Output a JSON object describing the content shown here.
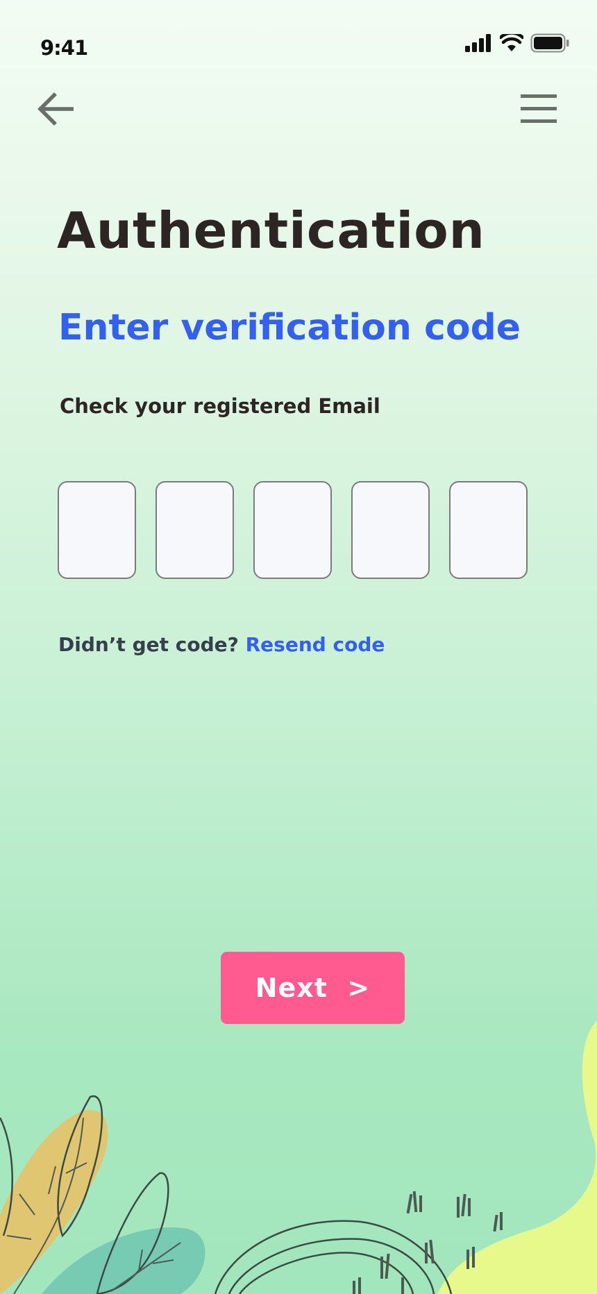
{
  "status_bar": {
    "time": "9:41"
  },
  "nav": {
    "back_icon": "arrow-left-icon",
    "menu_icon": "hamburger-menu-icon"
  },
  "screen": {
    "title": "Authentication",
    "subtitle": "Enter verification code",
    "hint": "Check your registered Email",
    "code_boxes": [
      "",
      "",
      "",
      "",
      ""
    ],
    "resend_prefix": "Didn’t get code?",
    "resend_link": "Resend code",
    "next_button": "Next  >"
  },
  "colors": {
    "accent_blue": "#3360ef",
    "button_pink": "#ff5b91",
    "title_dark": "#2d2424"
  }
}
